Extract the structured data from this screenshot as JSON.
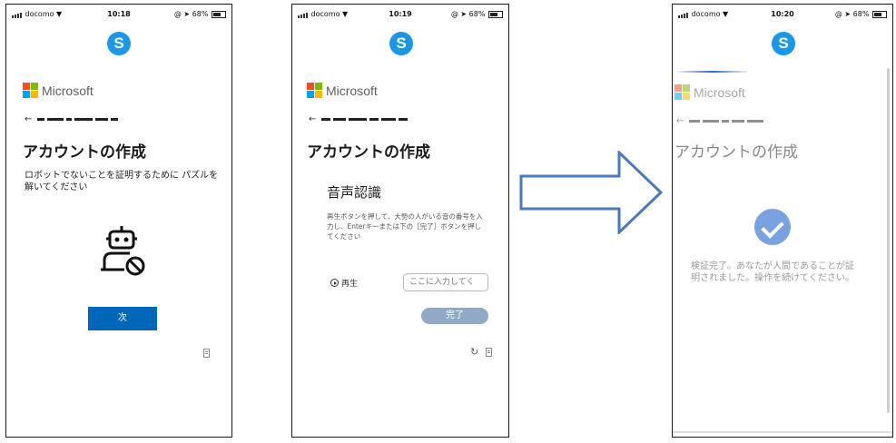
{
  "status": {
    "carrier": "docomo",
    "battery": "68%"
  },
  "screens": [
    {
      "time": "10:18",
      "brand": "Microsoft",
      "title": "アカウントの作成",
      "description": "ロボットでないことを証明するために パズルを解いてください",
      "next_label": "次"
    },
    {
      "time": "10:19",
      "brand": "Microsoft",
      "title": "アカウントの作成",
      "voice_title": "音声認識",
      "voice_instructions": "再生ボタンを押して、大勢の人がいる音の番号を入力し、Enterキーまたは下の［完了］ボタンを押してください",
      "play_label": "再生",
      "answer_placeholder": "ここに入力してく",
      "done_label": "完了"
    },
    {
      "time": "10:20",
      "brand": "Microsoft",
      "title": "アカウントの作成",
      "verified_message": "検証完了。あなたが人間であることが証明されました。操作を続けてください。"
    }
  ],
  "skype_letter": "S",
  "colors": {
    "skype_blue": "#1c97e6",
    "next_button": "#0067b8",
    "done_button": "#8fa9c7",
    "arrow_stroke": "#4a7ab8",
    "check": "#7aa2e0"
  },
  "icons": [
    "wifi-icon",
    "skype-icon",
    "microsoft-logo-icon",
    "back-arrow-icon",
    "robot-blocked-icon",
    "play-icon",
    "refresh-icon",
    "audio-icon",
    "checkmark-icon",
    "right-arrow-icon"
  ]
}
